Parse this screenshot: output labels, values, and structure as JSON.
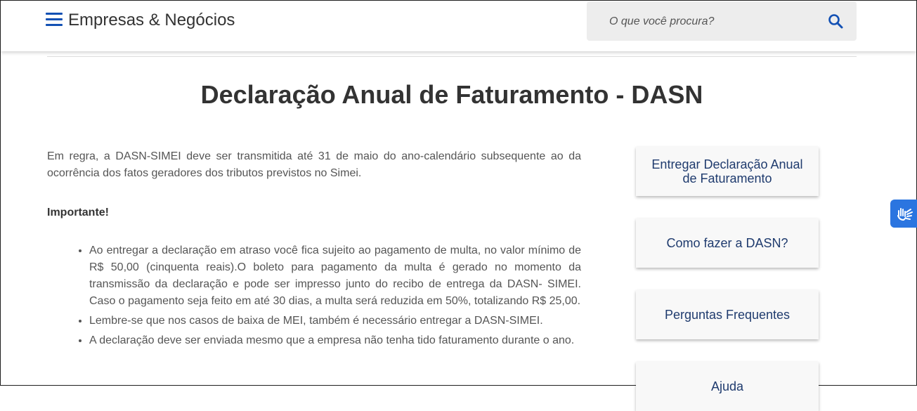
{
  "header": {
    "site_title": "Empresas & Negócios",
    "menu_icon": "hamburger-menu-icon",
    "search_placeholder": "O que você procura?",
    "search_icon": "search-icon",
    "accent_color": "#1351b4"
  },
  "main": {
    "title": "Declaração Anual de Faturamento - DASN",
    "intro": "Em regra, a DASN-SIMEI deve ser transmitida até 31 de maio do ano-calendário subsequente ao da ocorrência dos fatos geradores dos tributos previstos no Simei.",
    "important_label": "Importante!",
    "bullets": [
      "Ao entregar a declaração em atraso você fica sujeito ao pagamento de multa, no valor mínimo de R$ 50,00 (cinquenta reais).O boleto para pagamento da multa é gerado no momento da transmissão da declaração e pode ser impresso junto do recibo de entrega da DASN- SIMEI. Caso o pagamento seja feito em até 30 dias, a multa será reduzida em 50%, totalizando R$ 25,00.",
      "Lembre-se que nos casos de baixa de MEI, também é necessário entregar a DASN-SIMEI.",
      "A declaração deve ser enviada mesmo que a empresa não tenha tido faturamento durante o ano."
    ]
  },
  "sidebar": {
    "buttons": [
      "Entregar Declaração Anual de Faturamento",
      "Como fazer a DASN?",
      "Perguntas Frequentes",
      "Ajuda"
    ]
  },
  "accessibility": {
    "icon": "sign-language-hands-icon",
    "color": "#2b75e0"
  }
}
